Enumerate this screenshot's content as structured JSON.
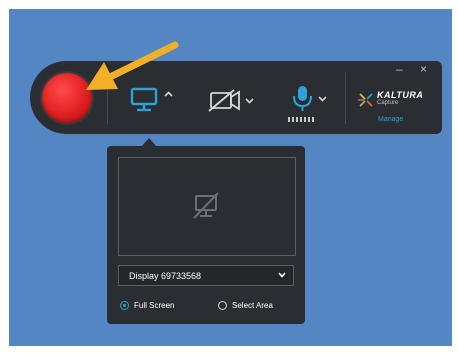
{
  "toolbar": {
    "record_label": "Record",
    "brand_name": "KALTURA",
    "brand_sub": "Capture",
    "manage_link": "Manage",
    "minimize": "–",
    "close": "×"
  },
  "icons": {
    "screen": "monitor-icon",
    "camera": "camera-off-icon",
    "mic": "microphone-icon"
  },
  "colors": {
    "accent": "#2aa3d8",
    "record": "#e02020",
    "toolbar_bg": "#2a2d31",
    "desktop_bg": "#5586c4",
    "annotation_arrow": "#f1b025"
  },
  "popover": {
    "display_value": "Display 69733568",
    "option_full": "Full Screen",
    "option_area": "Select Area",
    "selected": "Full Screen"
  },
  "mic_level": {
    "level": 0.0
  }
}
